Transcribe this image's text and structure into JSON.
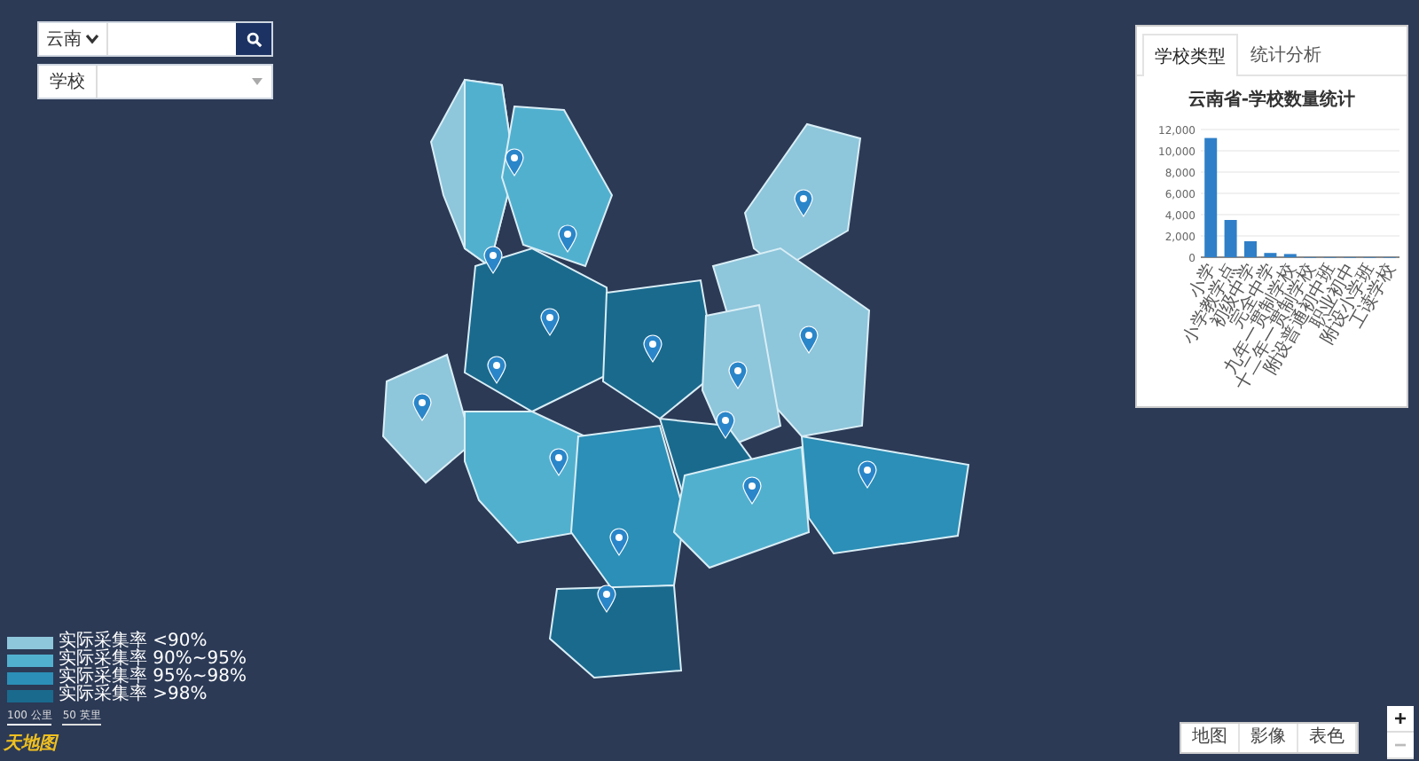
{
  "search": {
    "region": "云南",
    "school_label": "学校"
  },
  "panel": {
    "tabs": [
      {
        "label": "学校类型",
        "selected": true
      },
      {
        "label": "统计分析",
        "selected": false
      }
    ],
    "chart_data": {
      "type": "bar",
      "title": "云南省-学校数量统计",
      "categories": [
        "小学",
        "小学教学点",
        "初级中学",
        "完全中学",
        "九年一贯制学校",
        "十二年一贯制学校",
        "附设普通初中班",
        "职业初中",
        "附设小学班",
        "工读学校"
      ],
      "ylim": [
        0,
        12000
      ],
      "grid": true,
      "yticks": [
        {
          "value": 0,
          "label": "0"
        },
        {
          "value": 2000,
          "label": "2,000"
        },
        {
          "value": 4000,
          "label": "4,000"
        },
        {
          "value": 6000,
          "label": "6,000"
        },
        {
          "value": 8000,
          "label": "8,000"
        },
        {
          "value": 10000,
          "label": "10,000"
        },
        {
          "value": 12000,
          "label": "12,000"
        }
      ],
      "series": [
        {
          "color": "#2f7fc8",
          "values": [
            11200,
            3500,
            1500,
            400,
            300,
            0,
            0,
            0,
            0,
            0
          ]
        }
      ]
    }
  },
  "legend": [
    {
      "label": "实际采集率 <90%",
      "color": "#8ec6db"
    },
    {
      "label": "实际采集率 90%~95%",
      "color": "#52b0cf"
    },
    {
      "label": "实际采集率 95%~98%",
      "color": "#2b8fb7"
    },
    {
      "label": "实际采集率 >98%",
      "color": "#1a6a8e"
    }
  ],
  "scale": {
    "metric": "100 公里",
    "imperial": "50 英里"
  },
  "logo": "天地图",
  "layers": [
    {
      "label": "地图"
    },
    {
      "label": "影像"
    },
    {
      "label": "表色"
    }
  ],
  "zoom": [
    {
      "label": "+",
      "disabled": false
    },
    {
      "label": "−",
      "disabled": true
    }
  ]
}
